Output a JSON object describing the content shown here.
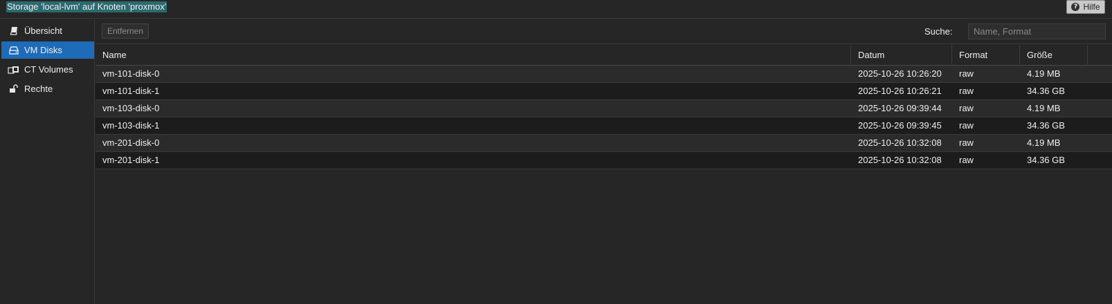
{
  "window": {
    "title": "Storage 'local-lvm' auf Knoten 'proxmox'",
    "help_label": "Hilfe"
  },
  "sidebar": {
    "items": [
      {
        "label": "Übersicht",
        "icon": "book-icon",
        "active": false
      },
      {
        "label": "VM Disks",
        "icon": "hdd-icon",
        "active": true
      },
      {
        "label": "CT Volumes",
        "icon": "cubes-icon",
        "active": false
      },
      {
        "label": "Rechte",
        "icon": "unlock-icon",
        "active": false
      }
    ]
  },
  "toolbar": {
    "remove_label": "Entfernen",
    "search_label": "Suche:",
    "search_placeholder": "Name, Format",
    "search_value": ""
  },
  "grid": {
    "columns": [
      "Name",
      "Datum",
      "Format",
      "Größe"
    ],
    "rows": [
      {
        "name": "vm-101-disk-0",
        "date": "2025-10-26 10:26:20",
        "format": "raw",
        "size": "4.19 MB"
      },
      {
        "name": "vm-101-disk-1",
        "date": "2025-10-26 10:26:21",
        "format": "raw",
        "size": "34.36 GB"
      },
      {
        "name": "vm-103-disk-0",
        "date": "2025-10-26 09:39:44",
        "format": "raw",
        "size": "4.19 MB"
      },
      {
        "name": "vm-103-disk-1",
        "date": "2025-10-26 09:39:45",
        "format": "raw",
        "size": "34.36 GB"
      },
      {
        "name": "vm-201-disk-0",
        "date": "2025-10-26 10:32:08",
        "format": "raw",
        "size": "4.19 MB"
      },
      {
        "name": "vm-201-disk-1",
        "date": "2025-10-26 10:32:08",
        "format": "raw",
        "size": "34.36 GB"
      }
    ]
  },
  "colors": {
    "background": "#262626",
    "accent": "#1e6bb8",
    "title_highlight": "#2b6a6e"
  }
}
